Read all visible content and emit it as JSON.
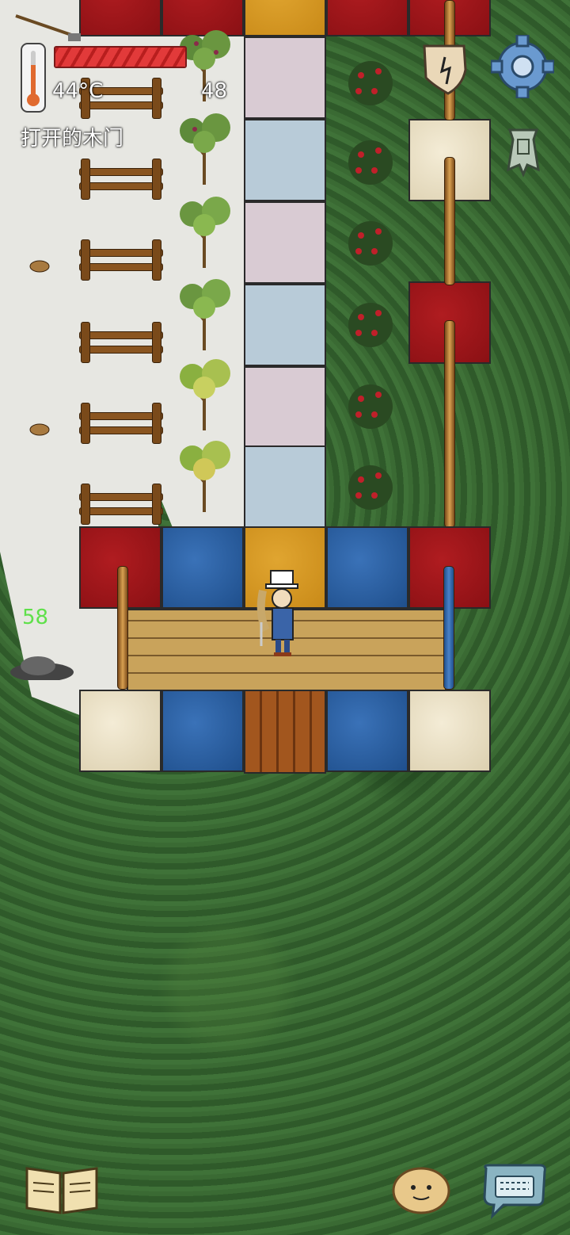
{
  "hud": {
    "temperature": "44°C",
    "age": "48",
    "status_text": "打开的木门",
    "floating_number": "58",
    "health_fraction": 1.0
  },
  "icons": {
    "thermometer": "thermometer-icon",
    "settings": "gear-icon",
    "clock": "melting-clock-icon",
    "coin": "ancient-coin-icon",
    "book": "recipe-book-icon",
    "emote": "emote-face-icon",
    "chat": "keyboard-chat-icon"
  },
  "colors": {
    "health_bar": "#d62c2c",
    "age_text": "#ffffff",
    "floating_number": "#5fe04a"
  }
}
